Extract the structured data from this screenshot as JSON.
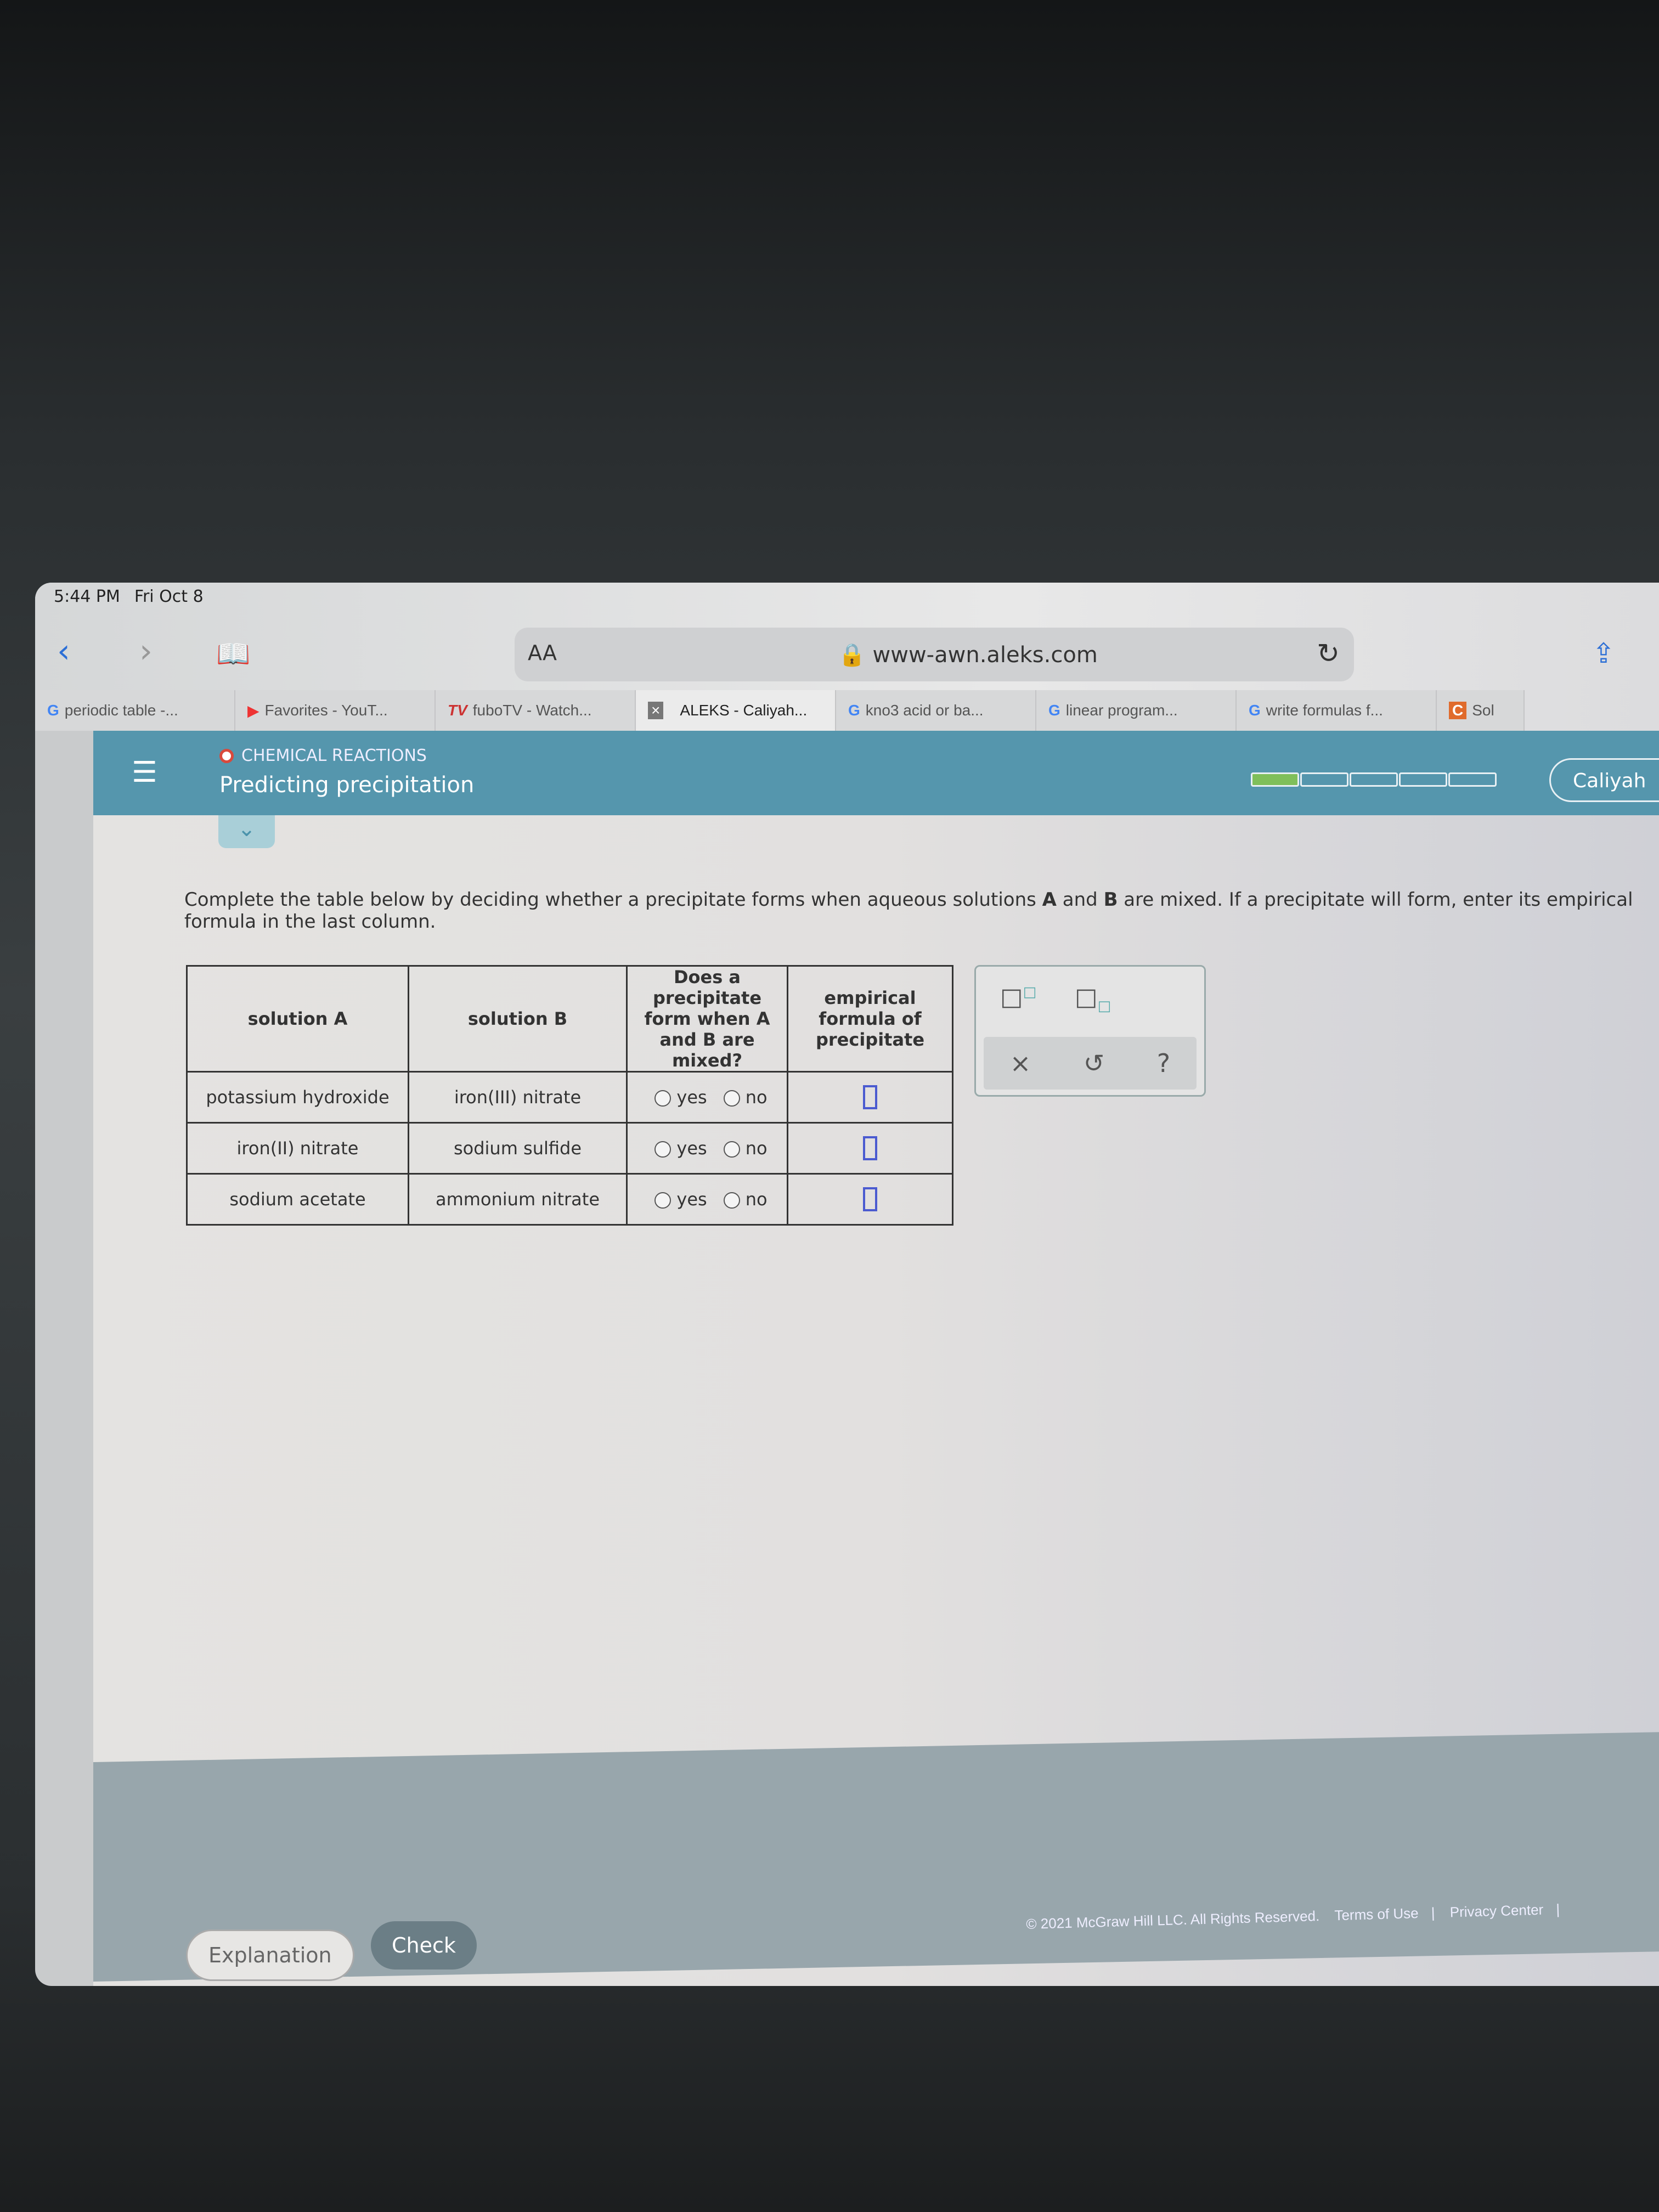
{
  "status": {
    "time": "5:44 PM",
    "date": "Fri Oct 8"
  },
  "browser": {
    "text_size": "AA",
    "url": "www-awn.aleks.com",
    "tabs": [
      {
        "icon": "google-icon",
        "label": "periodic table -..."
      },
      {
        "icon": "youtube-icon",
        "label": "Favorites - YouT..."
      },
      {
        "icon": "fubotv-icon",
        "label": "fuboTV - Watch..."
      },
      {
        "icon": "close-icon",
        "label": "ALEKS - Caliyah...",
        "active": true
      },
      {
        "icon": "google-icon",
        "label": "kno3 acid or ba..."
      },
      {
        "icon": "google-icon",
        "label": "linear program..."
      },
      {
        "icon": "google-icon",
        "label": "write formulas f..."
      },
      {
        "icon": "chegg-icon",
        "label": "Sol"
      }
    ]
  },
  "header": {
    "topic": "CHEMICAL REACTIONS",
    "title": "Predicting precipitation",
    "user": "Caliyah",
    "progress_segments": 5,
    "progress_completed": 1,
    "accent": "#5596ad"
  },
  "instructions": {
    "pre": "Complete the table below by deciding whether a precipitate forms when aqueous solutions ",
    "a": "A",
    "mid": " and ",
    "b": "B",
    "post": " are mixed. If a precipitate will form, enter its empirical formula in the last column."
  },
  "table": {
    "headers": [
      "solution A",
      "solution B",
      "Does a precipitate form when A and B are mixed?",
      "empirical formula of precipitate"
    ],
    "yes": "yes",
    "no": "no",
    "rows": [
      {
        "a": "potassium hydroxide",
        "b": "iron(III) nitrate"
      },
      {
        "a": "iron(II) nitrate",
        "b": "sodium sulfide"
      },
      {
        "a": "sodium acetate",
        "b": "ammonium nitrate"
      }
    ]
  },
  "tools": {
    "superscript": "□□",
    "subscript": "□□",
    "clear": "×",
    "undo": "↺",
    "help": "?"
  },
  "buttons": {
    "explanation": "Explanation",
    "check": "Check"
  },
  "footer": {
    "copyright": "© 2021 McGraw Hill LLC. All Rights Reserved.",
    "terms": "Terms of Use",
    "sep": "|",
    "privacy": "Privacy Center",
    "sep2": "|"
  }
}
